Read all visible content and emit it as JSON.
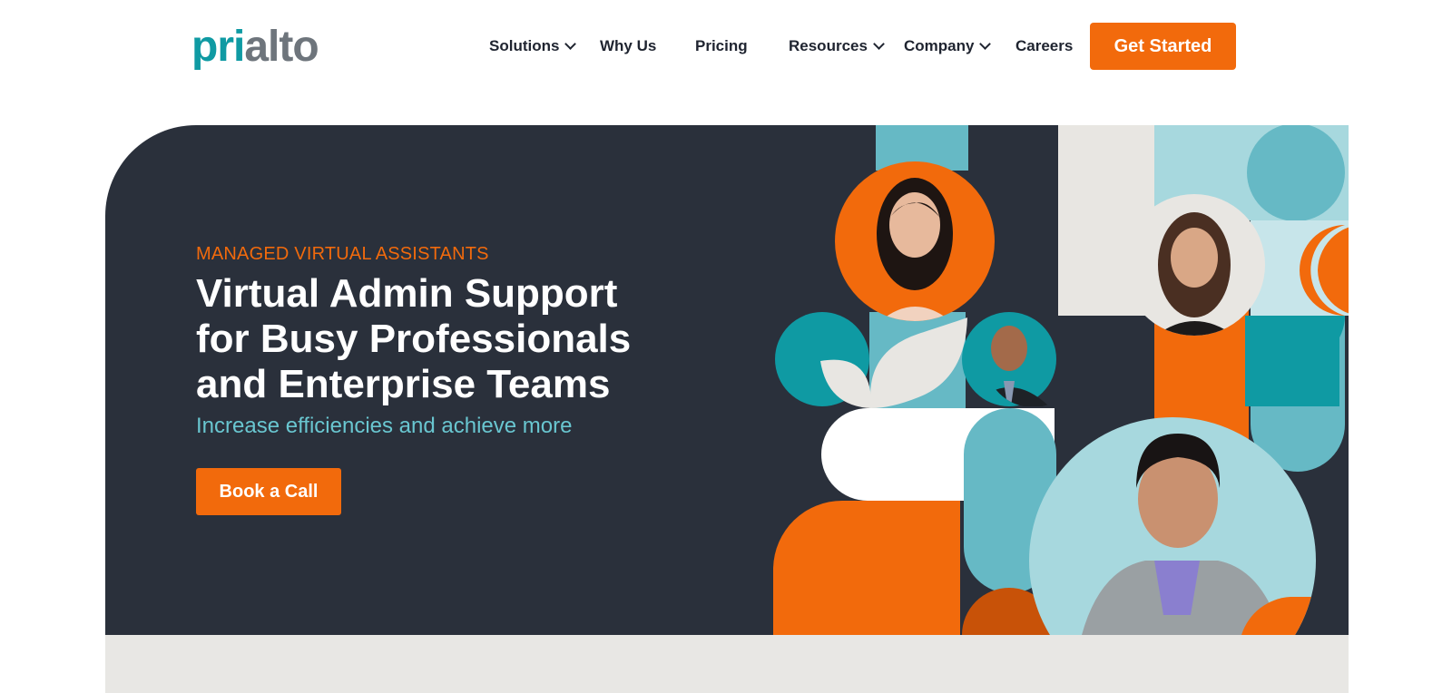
{
  "brand": {
    "part1": "pri",
    "part2": "alto"
  },
  "nav": {
    "items": [
      {
        "label": "Solutions",
        "dropdown": true
      },
      {
        "label": "Why Us",
        "dropdown": false
      },
      {
        "label": "Pricing",
        "dropdown": false
      },
      {
        "label": "Resources",
        "dropdown": true
      },
      {
        "label": "Company",
        "dropdown": true
      },
      {
        "label": "Careers",
        "dropdown": false
      }
    ],
    "cta": "Get Started"
  },
  "hero": {
    "eyebrow": "MANAGED VIRTUAL ASSISTANTS",
    "headline": [
      "Virtual Admin Support",
      "for Busy Professionals",
      "and Enterprise Teams"
    ],
    "subhead": "Increase efficiencies and achieve more",
    "cta": "Book a Call"
  },
  "colors": {
    "accent_orange": "#f26a0c",
    "dark_navy": "#2a303b",
    "teal": "#0f9aa3",
    "light_teal": "#69c6d0",
    "pale_teal": "#a7d8de",
    "cream": "#e8e6e2",
    "logo_gray": "#6e757c"
  },
  "icons": [
    "chevron-down-icon"
  ]
}
